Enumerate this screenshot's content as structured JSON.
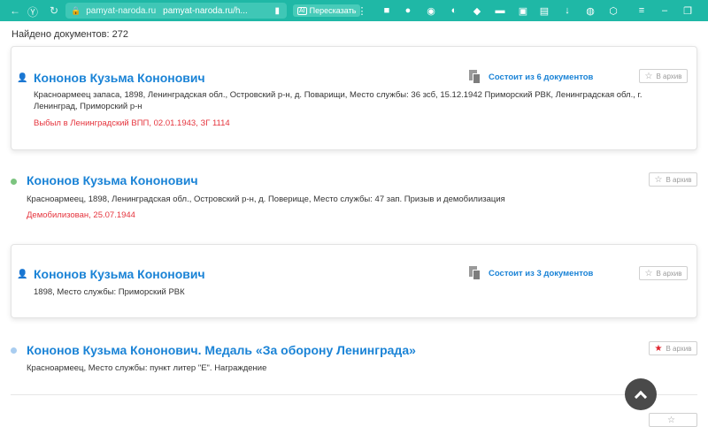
{
  "browser": {
    "domain": "pamyat-naroda.ru",
    "url": "pamyat-naroda.ru/h...",
    "retell_label": "Пересказать",
    "ai_badge": "AI"
  },
  "results_count": "Найдено документов: 272",
  "records": [
    {
      "name": "Кононов Кузьма Кононович",
      "description": "Красноармеец запаса, 1898, Ленинградская обл., Островский р-н, д. Поварищи, Место службы: 36 зсб, 15.12.1942 Приморский РВК, Ленинградская обл., г. Ленинград, Приморский р-н",
      "status": "Выбыл в Ленинградский ВПП, 02.01.1943, ЗГ 1114",
      "docs_label": "Состоит из 6 документов",
      "archive_label": "В архив"
    },
    {
      "name": "Кононов Кузьма Кононович",
      "description": "Красноармеец, 1898, Ленинградская обл., Островский р-н, д. Поверище, Место службы: 47 зап. Призыв и демобилизация",
      "status": "Демобилизован, 25.07.1944",
      "archive_label": "В архив"
    },
    {
      "name": "Кононов Кузьма Кононович",
      "description": "1898, Место службы: Приморский РВК",
      "docs_label": "Состоит из 3 документов",
      "archive_label": "В архив"
    },
    {
      "name": "Кононов Кузьма Кононович. Медаль «За оборону Ленинграда»",
      "description": "Красноармеец, Место службы: пункт литер \"Е\". Награждение",
      "archive_label": "В архив"
    }
  ],
  "colors": {
    "browser_bar": "#1fb8a6",
    "link": "#1a83d6",
    "status_red": "#e5343d",
    "dot_green": "#7cc47f",
    "dot_blue": "#a9cdf0"
  }
}
